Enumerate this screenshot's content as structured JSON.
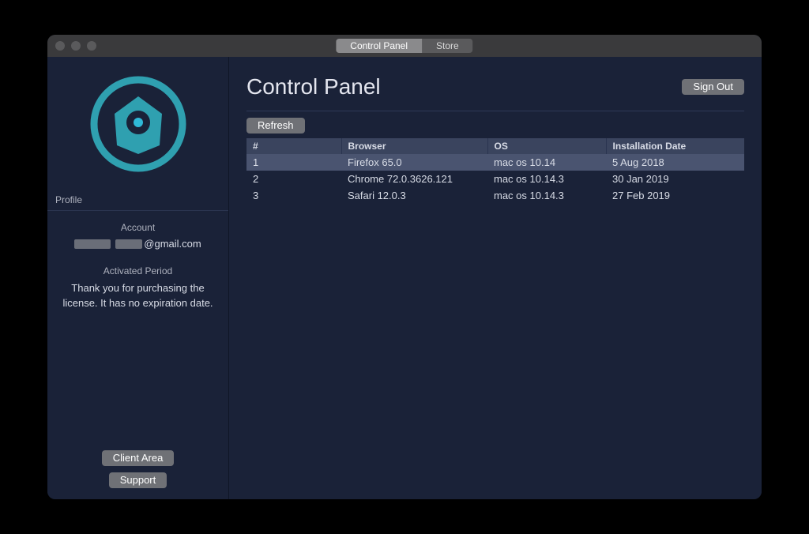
{
  "tabs": {
    "control_panel": "Control Panel",
    "store": "Store"
  },
  "sidebar": {
    "profile_label": "Profile",
    "account_label": "Account",
    "email_suffix": "@gmail.com",
    "activated_label": "Activated Period",
    "activated_msg": "Thank you for purchasing the license. It has no expiration date.",
    "client_area_btn": "Client Area",
    "support_btn": "Support"
  },
  "main": {
    "title": "Control Panel",
    "sign_out_btn": "Sign Out",
    "refresh_btn": "Refresh",
    "columns": {
      "num": "#",
      "browser": "Browser",
      "os": "OS",
      "date": "Installation Date"
    },
    "rows": [
      {
        "num": "1",
        "browser": "Firefox 65.0",
        "os": "mac os 10.14",
        "date": "5 Aug 2018",
        "selected": true
      },
      {
        "num": "2",
        "browser": "Chrome 72.0.3626.121",
        "os": "mac os 10.14.3",
        "date": "30 Jan 2019",
        "selected": false
      },
      {
        "num": "3",
        "browser": "Safari 12.0.3",
        "os": "mac os 10.14.3",
        "date": "27 Feb 2019",
        "selected": false
      }
    ]
  }
}
